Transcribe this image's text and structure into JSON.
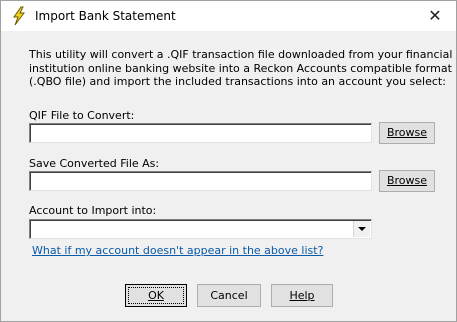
{
  "window": {
    "title": "Import Bank Statement",
    "icon": "lightning-bolt-icon",
    "close_symbol": "✕"
  },
  "description": {
    "lines": [
      "This utility will convert a .QIF transaction file downloaded from your financial",
      "institution online banking website into a Reckon Accounts compatible format",
      "(.QBO file) and import the included transactions into an account you select:"
    ]
  },
  "qif_file": {
    "label": "QIF File to Convert:",
    "value": "",
    "browse_label": "Browse"
  },
  "save_file": {
    "label": "Save Converted File As:",
    "value": "",
    "browse_label": "Browse"
  },
  "account": {
    "label": "Account to Import into:",
    "selected": ""
  },
  "help_link": "What if my account doesn't appear in the above list?",
  "buttons": {
    "ok": "OK",
    "cancel": "Cancel",
    "help": "Help"
  },
  "colors": {
    "link": "#0a5aa8",
    "icon_yellow": "#f5d21f"
  }
}
